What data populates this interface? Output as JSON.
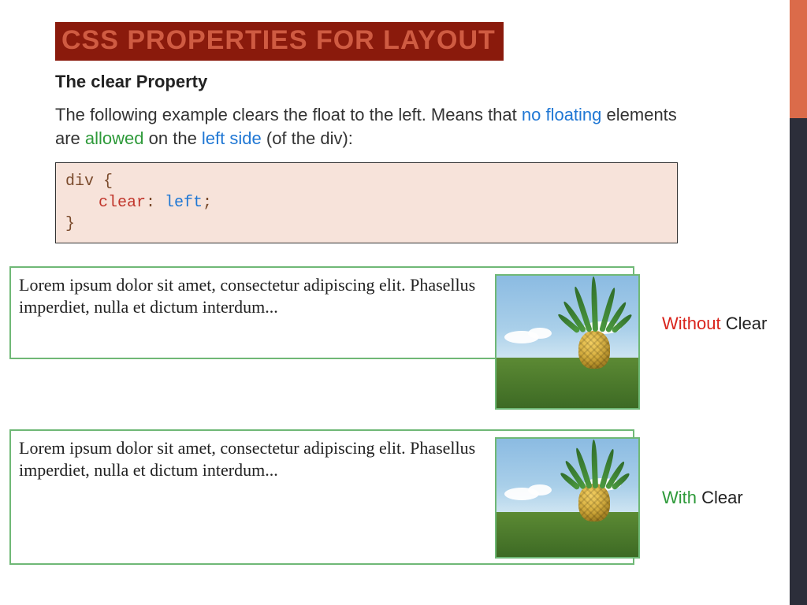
{
  "title": "CSS PROPERTIES FOR LAYOUT",
  "subhead": "The clear Property",
  "body": {
    "t1": "The following example clears the float to the left. Means that ",
    "no_floating": "no floating",
    "t2": " elements are ",
    "allowed": "allowed",
    "t3": " on the ",
    "left_side": "left side",
    "t4": " (of the div):"
  },
  "code": {
    "selector": "div",
    "open": " {",
    "prop": "clear",
    "colon": ": ",
    "value": "left",
    "semicolon": ";",
    "close": "}"
  },
  "lorem": "Lorem ipsum dolor sit amet, consectetur adipiscing elit. Phasellus imperdiet, nulla et dictum interdum...",
  "labels": {
    "without": "Without",
    "with": "With",
    "clear": " Clear"
  }
}
